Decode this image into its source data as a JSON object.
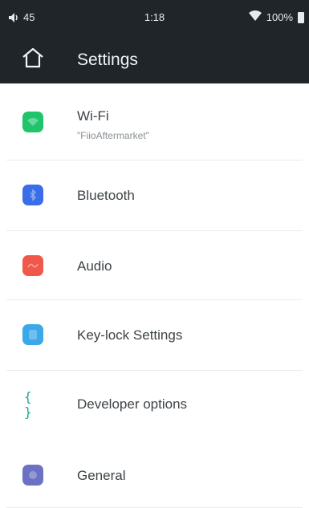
{
  "status_bar": {
    "volume": "45",
    "time": "1:18",
    "battery": "100%"
  },
  "app_bar": {
    "title": "Settings"
  },
  "settings": {
    "items": [
      {
        "label": "Wi-Fi",
        "subtitle": "\"FiioAftermarket\"",
        "icon": "wifi-icon",
        "color": "#1fc46b"
      },
      {
        "label": "Bluetooth",
        "icon": "bluetooth-icon",
        "color": "#3a6ee8"
      },
      {
        "label": "Audio",
        "icon": "audio-icon",
        "color": "#f0594a"
      },
      {
        "label": "Key-lock Settings",
        "icon": "key-lock-icon",
        "color": "#3aa8e9"
      },
      {
        "label": "Developer options",
        "icon": "developer-options-icon",
        "glyph": "{ }",
        "color": "#1aa991"
      },
      {
        "label": "General",
        "icon": "general-icon",
        "color": "#6b72c4"
      }
    ]
  },
  "colors": {
    "bar_background": "#1f2529",
    "page_background": "#ffffff"
  }
}
